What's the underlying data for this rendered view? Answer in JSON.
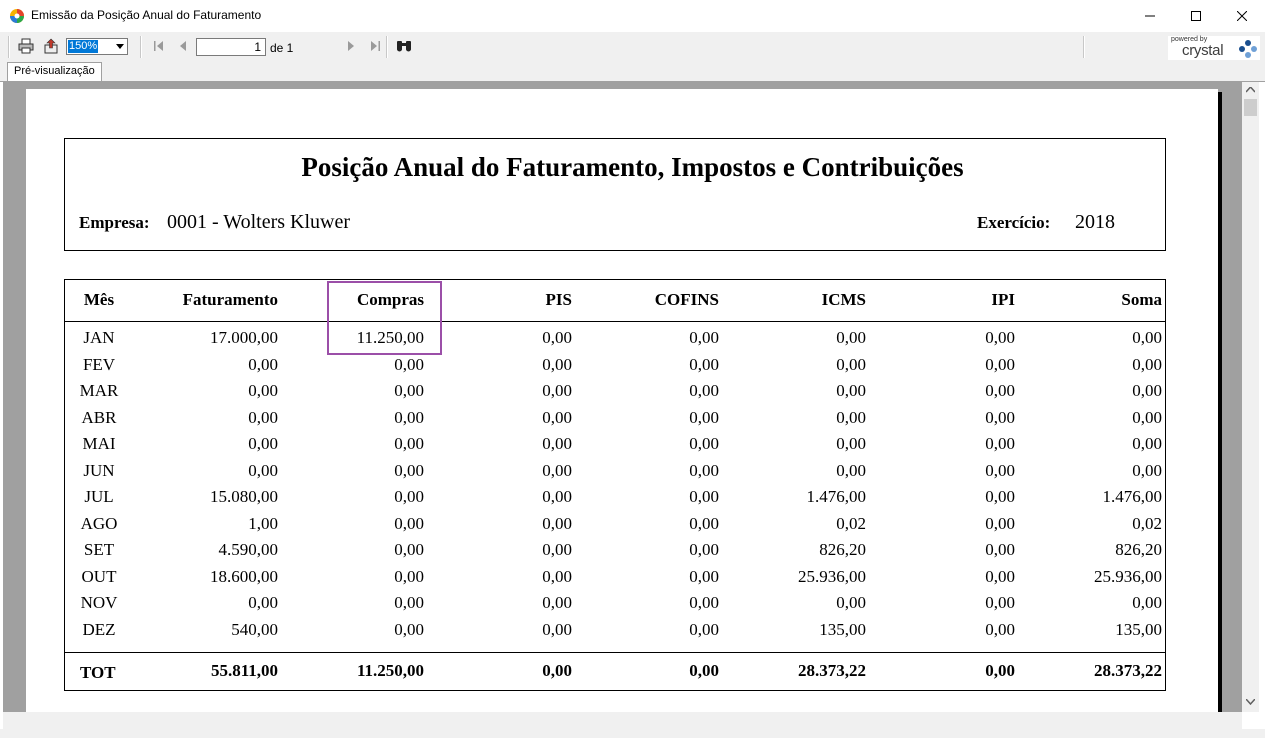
{
  "window": {
    "title": "Emissão da Posição Anual do Faturamento"
  },
  "toolbar": {
    "zoom": "150%",
    "page_current": "1",
    "page_total_label": "de 1"
  },
  "brand": {
    "powered": "powered by",
    "name": "crystal"
  },
  "tab": {
    "label": "Pré-visualização"
  },
  "report": {
    "title": "Posição Anual do Faturamento, Impostos e Contribuições",
    "empresa_label": "Empresa:",
    "empresa_value": "0001 - Wolters Kluwer",
    "exercicio_label": "Exercício:",
    "exercicio_value": "2018",
    "columns": [
      "Mês",
      "Faturamento",
      "Compras",
      "PIS",
      "COFINS",
      "ICMS",
      "IPI",
      "Soma"
    ],
    "rows": [
      [
        "JAN",
        "17.000,00",
        "11.250,00",
        "0,00",
        "0,00",
        "0,00",
        "0,00",
        "0,00"
      ],
      [
        "FEV",
        "0,00",
        "0,00",
        "0,00",
        "0,00",
        "0,00",
        "0,00",
        "0,00"
      ],
      [
        "MAR",
        "0,00",
        "0,00",
        "0,00",
        "0,00",
        "0,00",
        "0,00",
        "0,00"
      ],
      [
        "ABR",
        "0,00",
        "0,00",
        "0,00",
        "0,00",
        "0,00",
        "0,00",
        "0,00"
      ],
      [
        "MAI",
        "0,00",
        "0,00",
        "0,00",
        "0,00",
        "0,00",
        "0,00",
        "0,00"
      ],
      [
        "JUN",
        "0,00",
        "0,00",
        "0,00",
        "0,00",
        "0,00",
        "0,00",
        "0,00"
      ],
      [
        "JUL",
        "15.080,00",
        "0,00",
        "0,00",
        "0,00",
        "1.476,00",
        "0,00",
        "1.476,00"
      ],
      [
        "AGO",
        "1,00",
        "0,00",
        "0,00",
        "0,00",
        "0,02",
        "0,00",
        "0,02"
      ],
      [
        "SET",
        "4.590,00",
        "0,00",
        "0,00",
        "0,00",
        "826,20",
        "0,00",
        "826,20"
      ],
      [
        "OUT",
        "18.600,00",
        "0,00",
        "0,00",
        "0,00",
        "25.936,00",
        "0,00",
        "25.936,00"
      ],
      [
        "NOV",
        "0,00",
        "0,00",
        "0,00",
        "0,00",
        "0,00",
        "0,00",
        "0,00"
      ],
      [
        "DEZ",
        "540,00",
        "0,00",
        "0,00",
        "0,00",
        "135,00",
        "0,00",
        "135,00"
      ]
    ],
    "total": [
      "TOT",
      "55.811,00",
      "11.250,00",
      "0,00",
      "0,00",
      "28.373,22",
      "0,00",
      "28.373,22"
    ]
  },
  "colors": {
    "highlight": "#9b4fa8",
    "zoom_selection": "#0078d7"
  }
}
